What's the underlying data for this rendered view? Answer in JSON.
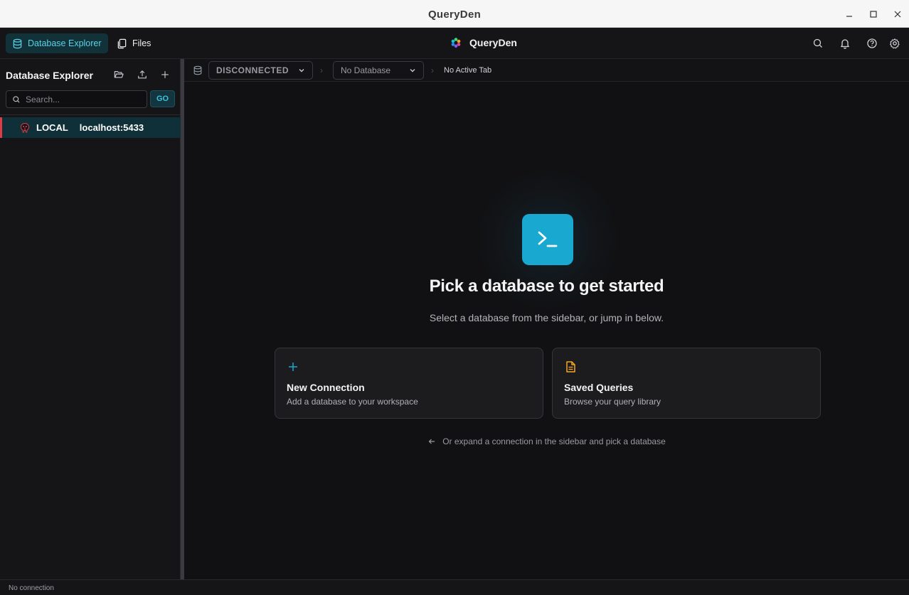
{
  "window": {
    "title": "QueryDen"
  },
  "header": {
    "tabs": [
      {
        "label": "Database Explorer",
        "icon": "database-icon",
        "active": true
      },
      {
        "label": "Files",
        "icon": "files-icon",
        "active": false
      }
    ],
    "brand": "QueryDen"
  },
  "sidebar": {
    "title": "Database Explorer",
    "search": {
      "placeholder": "Search...",
      "value": ""
    },
    "go_label": "GO",
    "connections": [
      {
        "name": "LOCAL",
        "host": "localhost:5433",
        "icon": "postgres-elephant-icon"
      }
    ]
  },
  "toolbar": {
    "connection_status": "DISCONNECTED",
    "database": "No Database",
    "active_tab": "No Active Tab"
  },
  "main": {
    "title": "Pick a database to get started",
    "subtitle": "Select a database from the sidebar, or jump in below.",
    "cards": [
      {
        "title": "New Connection",
        "description": "Add a database to your workspace",
        "icon": "plus-icon"
      },
      {
        "title": "Saved Queries",
        "description": "Browse your query library",
        "icon": "document-icon"
      }
    ],
    "hint": "Or expand a connection in the sidebar and pick a database"
  },
  "status": {
    "text": "No connection"
  },
  "colors": {
    "accent": "#19a8cf",
    "connection_marker": "#e03a45",
    "saved_queries_icon": "#f5a524"
  }
}
